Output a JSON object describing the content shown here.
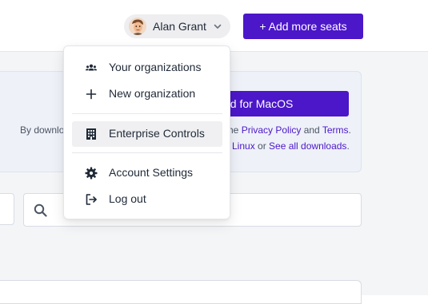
{
  "header": {
    "user_name": "Alan Grant",
    "avatar_icon": "memoji-avatar",
    "chevron_icon": "chevron-down-icon",
    "add_seats_label": "+ Add more seats",
    "accent_color": "#4b17c9"
  },
  "download": {
    "button_label": "nd for MacOS",
    "prefix_text": "By downlo",
    "legal": {
      "pre": "he ",
      "privacy_link": "Privacy Policy",
      "and": " and ",
      "terms_link": "Terms",
      "end": "."
    },
    "platforms": {
      "linux_link": "Linux",
      "or": " or ",
      "all_link": "See all downloads",
      "end": "."
    }
  },
  "search": {
    "icon": "search-icon"
  },
  "menu": {
    "items": [
      {
        "label": "Your organizations",
        "icon": "people-icon"
      },
      {
        "label": "New organization",
        "icon": "plus-icon"
      },
      {
        "label": "Enterprise Controls",
        "icon": "building-icon"
      },
      {
        "label": "Account Settings",
        "icon": "gear-icon"
      },
      {
        "label": "Log out",
        "icon": "logout-icon"
      }
    ]
  }
}
